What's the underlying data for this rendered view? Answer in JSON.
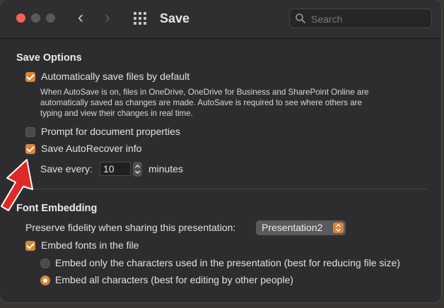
{
  "window": {
    "title": "Save"
  },
  "search": {
    "placeholder": "Search"
  },
  "colors": {
    "accent": "#d9853b",
    "close": "#ff5f57",
    "arrow": "#e02828"
  },
  "save_options": {
    "heading": "Save Options",
    "autosave": {
      "label": "Automatically save files by default",
      "checked": true,
      "description_lines": [
        "When AutoSave is on, files in OneDrive, OneDrive for Business and SharePoint Online are",
        "automatically saved as changes are made. AutoSave is required to see where others are",
        "typing and view their changes in real time."
      ]
    },
    "prompt_properties": {
      "label": "Prompt for document properties",
      "checked": false
    },
    "autorecover": {
      "label": "Save AutoRecover info",
      "checked": true
    },
    "save_every": {
      "label": "Save every:",
      "value": "10",
      "unit": "minutes"
    }
  },
  "font_embedding": {
    "heading": "Font Embedding",
    "preserve_label": "Preserve fidelity when sharing this presentation:",
    "presentation_select": "Presentation2",
    "embed_fonts": {
      "label": "Embed fonts in the file",
      "checked": true
    },
    "options": [
      {
        "label": "Embed only the characters used in the presentation (best for reducing file size)",
        "selected": false
      },
      {
        "label": "Embed all characters (best for editing by other people)",
        "selected": true
      }
    ]
  }
}
